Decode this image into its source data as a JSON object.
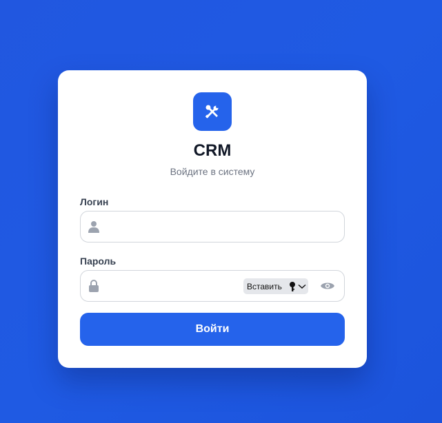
{
  "brand": {
    "title": "CRM",
    "subtitle": "Войдите в систему",
    "logo_icon": "tools-icon",
    "accent_color": "#2563eb"
  },
  "form": {
    "login": {
      "label": "Логин",
      "value": "",
      "icon": "user-icon"
    },
    "password": {
      "label": "Пароль",
      "value": "",
      "icon": "lock-icon",
      "paste_label": "Вставить",
      "paste_icon": "key-icon",
      "toggle_icon": "eye-icon"
    },
    "submit_label": "Войти"
  }
}
